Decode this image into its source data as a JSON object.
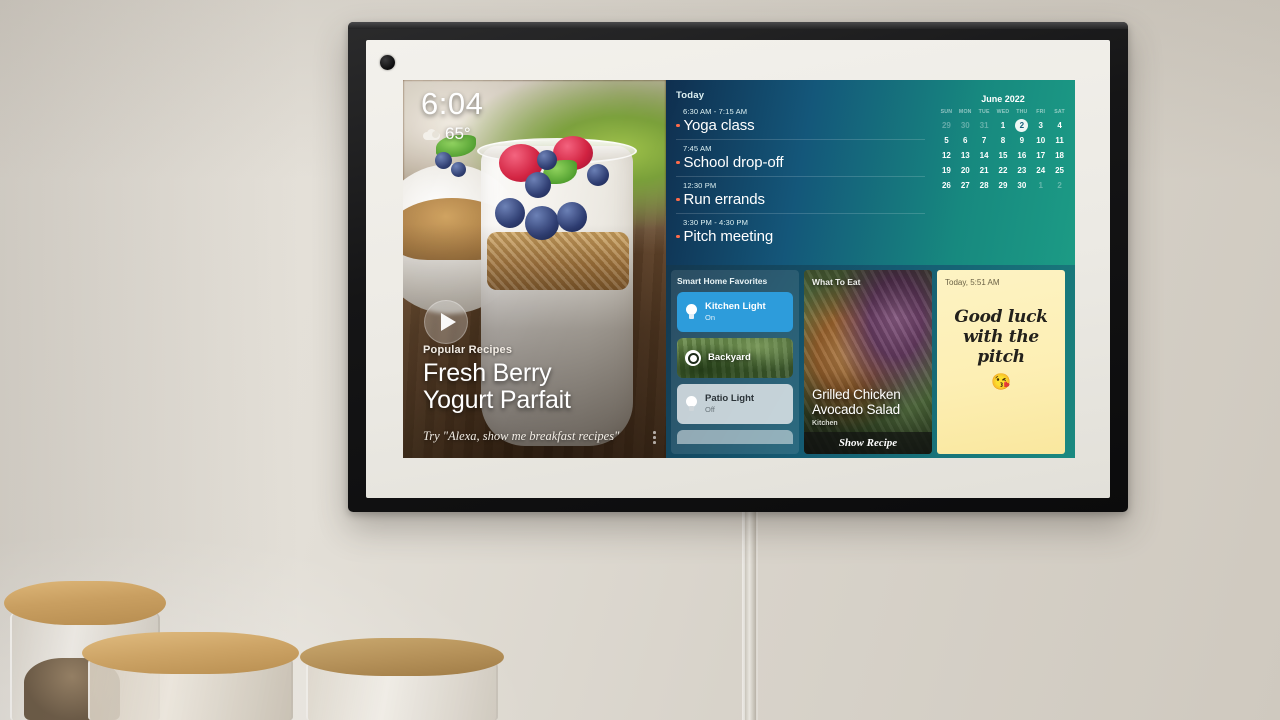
{
  "device": {
    "name": "smart-display",
    "camera_dot": "camera-icon"
  },
  "hero": {
    "clock": "6:04",
    "temperature": "65°",
    "weather_icon": "cloud-icon",
    "play_icon": "play-icon",
    "kicker": "Popular Recipes",
    "title_line1": "Fresh Berry",
    "title_line2": "Yogurt Parfait",
    "prompt": "Try \"Alexa, show me breakfast recipes\"",
    "menu_icon": "kebab-menu-icon"
  },
  "agenda": {
    "label": "Today",
    "events": [
      {
        "time": "6:30 AM - 7:15 AM",
        "title": "Yoga class"
      },
      {
        "time": "7:45 AM",
        "title": "School drop-off"
      },
      {
        "time": "12:30 PM",
        "title": "Run errands"
      },
      {
        "time": "3:30 PM - 4:30 PM",
        "title": "Pitch meeting"
      }
    ],
    "dot_color": "#ff6b4a"
  },
  "calendar": {
    "title": "June 2022",
    "dow": [
      "SUN",
      "MON",
      "TUE",
      "WED",
      "THU",
      "FRI",
      "SAT"
    ],
    "weeks": [
      [
        {
          "d": "29",
          "muted": true
        },
        {
          "d": "30",
          "muted": true
        },
        {
          "d": "31",
          "muted": true
        },
        {
          "d": "1"
        },
        {
          "d": "2",
          "today": true
        },
        {
          "d": "3"
        },
        {
          "d": "4"
        }
      ],
      [
        {
          "d": "5"
        },
        {
          "d": "6"
        },
        {
          "d": "7"
        },
        {
          "d": "8"
        },
        {
          "d": "9"
        },
        {
          "d": "10"
        },
        {
          "d": "11"
        }
      ],
      [
        {
          "d": "12"
        },
        {
          "d": "13"
        },
        {
          "d": "14"
        },
        {
          "d": "15"
        },
        {
          "d": "16"
        },
        {
          "d": "17"
        },
        {
          "d": "18"
        }
      ],
      [
        {
          "d": "19"
        },
        {
          "d": "20"
        },
        {
          "d": "21"
        },
        {
          "d": "22"
        },
        {
          "d": "23"
        },
        {
          "d": "24"
        },
        {
          "d": "25"
        }
      ],
      [
        {
          "d": "26"
        },
        {
          "d": "27"
        },
        {
          "d": "28"
        },
        {
          "d": "29"
        },
        {
          "d": "30"
        },
        {
          "d": "1",
          "muted": true
        },
        {
          "d": "2",
          "muted": true
        }
      ]
    ]
  },
  "smart_home": {
    "title": "Smart Home Favorites",
    "devices": [
      {
        "name": "Kitchen Light",
        "state": "On",
        "icon": "lightbulb-icon",
        "style": "on"
      },
      {
        "name": "Backyard",
        "state": "",
        "icon": "camera-icon",
        "style": "camera"
      },
      {
        "name": "Patio Light",
        "state": "Off",
        "icon": "lightbulb-icon",
        "style": "off"
      }
    ]
  },
  "what_to_eat": {
    "kicker": "What To Eat",
    "title_line1": "Grilled Chicken",
    "title_line2": "Avocado Salad",
    "source": "Kitchen",
    "button_label": "Show Recipe"
  },
  "note": {
    "timestamp": "Today, 5:51 AM",
    "line1": "Good luck",
    "line2": "with the",
    "line3": "pitch",
    "emoji": "😘"
  },
  "colors": {
    "accent_blue": "#2d9cdb",
    "agenda_gradient_start": "#0f2f4f",
    "agenda_gradient_end": "#1c9b85",
    "note_yellow": "#fdf3c3",
    "event_dot": "#ff6b4a"
  }
}
